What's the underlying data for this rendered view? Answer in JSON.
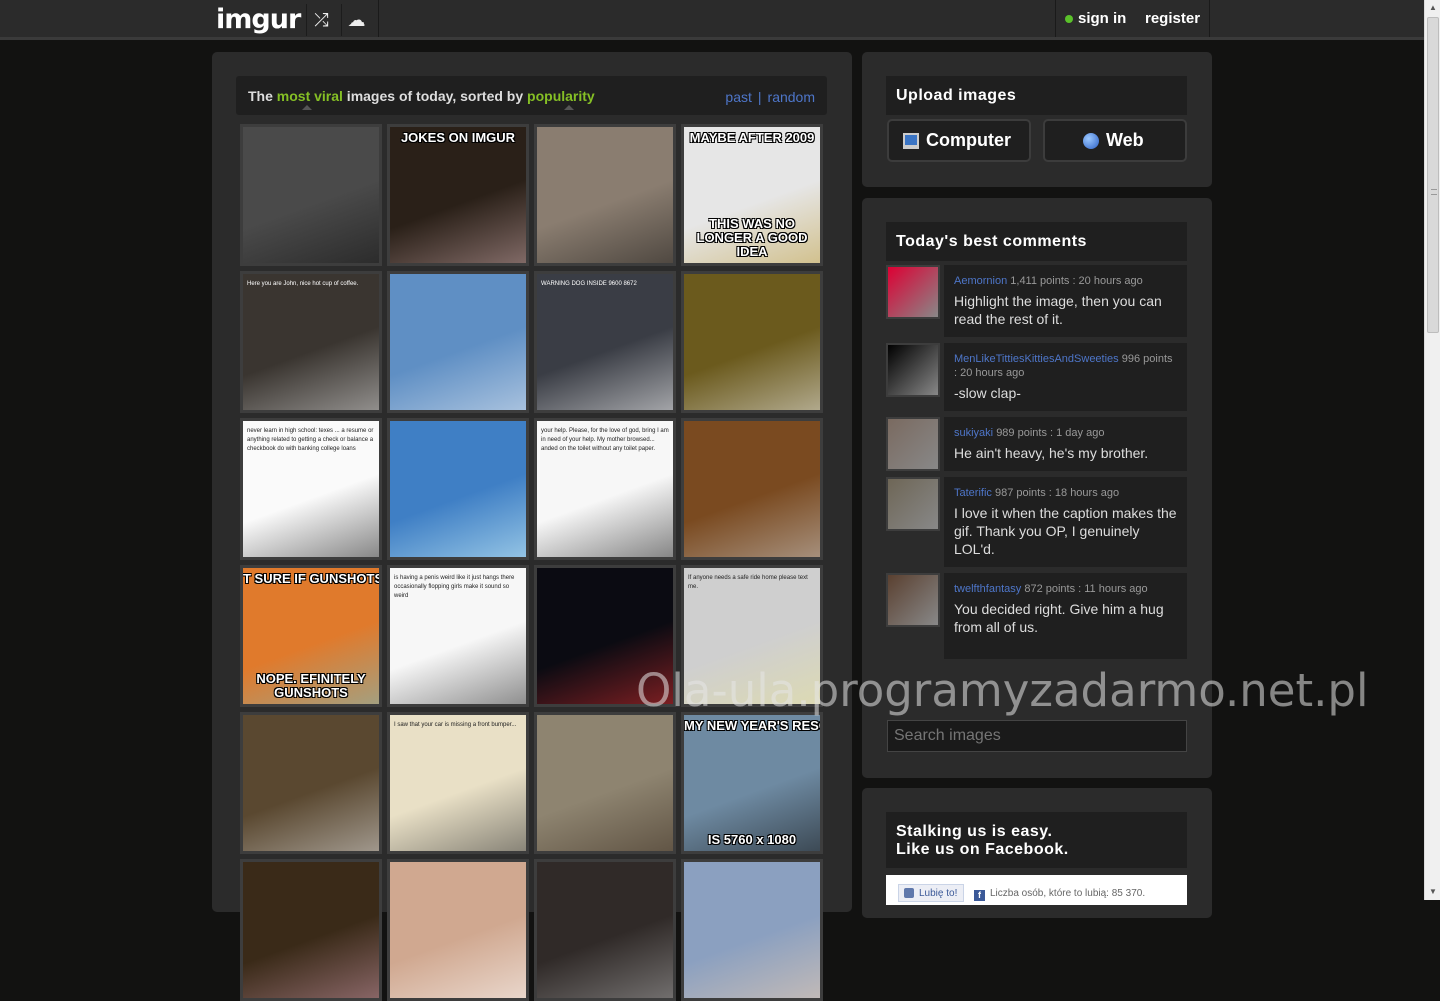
{
  "topbar": {
    "logo": "imgur",
    "random_icon": "⤮",
    "upload_icon": "☁",
    "signin": "sign in",
    "register": "register"
  },
  "gallery": {
    "title_prefix": "The ",
    "title_hl1": "most viral",
    "title_mid": " images of today, sorted by ",
    "title_hl2": "popularity",
    "link_past": "past",
    "link_sep": "|",
    "link_random": "random",
    "thumbs": [
      {
        "name": "tuxedo-cat",
        "bg": "#4a4a4a",
        "accent": "#111"
      },
      {
        "name": "most-interesting-man",
        "bg": "#2a2018",
        "accent": "#caa",
        "caption_top": "JOKES ON IMGUR"
      },
      {
        "name": "pug-puppy",
        "bg": "#8a7d70",
        "accent": "#1c1a18"
      },
      {
        "name": "new-year-meme",
        "bg": "#e6e6e6",
        "accent": "#c0a040",
        "caption_top": "MAYBE AFTER 2009",
        "caption_bottom": "THIS WAS NO LONGER A GOOD IDEA"
      },
      {
        "name": "sherlock-tea",
        "bg": "#3a3530",
        "accent": "#ddd",
        "text": "Here you are John, nice hot cup of coffee."
      },
      {
        "name": "feet-over-clouds",
        "bg": "#5f8fc4",
        "accent": "#e8eef5"
      },
      {
        "name": "warning-dog-sign",
        "bg": "#3a3d45",
        "accent": "#fff",
        "text": "WARNING DOG INSIDE 9600 8672"
      },
      {
        "name": "panda-reading",
        "bg": "#6b5a1d",
        "accent": "#eee"
      },
      {
        "name": "high-school-text",
        "bg": "#fafafa",
        "accent": "#222",
        "text": "never learn in high school: texes ... a resume or anything related to getting a check or balance a checkbook do with banking college loans"
      },
      {
        "name": "blue-bathroom",
        "bg": "#3f7fc5",
        "accent": "#dff"
      },
      {
        "name": "toilet-text",
        "bg": "#f7f7f7",
        "accent": "#222",
        "text": "your help. Please, for the love of god, bring I am in need of your help. My mother browsed... anded on the toilet without any toilet paper."
      },
      {
        "name": "brown-bathroom",
        "bg": "#7a4a20",
        "accent": "#ccc"
      },
      {
        "name": "fry-not-sure",
        "bg": "#e07a2c",
        "accent": "#6fc1c9",
        "caption_top": "T SURE IF GUNSHOTS O",
        "caption_bottom": "NOPE. EFINITELY GUNSHOTS"
      },
      {
        "name": "tumblr-text",
        "bg": "#f7f7f7",
        "accent": "#333",
        "text": "is having a penis weird like it just hangs there occasionally flopping girls make it sound so weird"
      },
      {
        "name": "fireworks-needle",
        "bg": "#0b0b12",
        "accent": "#e03030"
      },
      {
        "name": "text-messages",
        "bg": "#cfcfcf",
        "accent": "#e8e39a",
        "text": "If anyone needs a safe ride home please text me."
      },
      {
        "name": "sleeping-man",
        "bg": "#5a4830",
        "accent": "#ddd"
      },
      {
        "name": "car-note",
        "bg": "#e9e0c6",
        "accent": "#333",
        "text": "I saw that your car is missing a front bumper..."
      },
      {
        "name": "jack-sparrow",
        "bg": "#8e8470",
        "accent": "#3a2c20"
      },
      {
        "name": "monitor-setup",
        "bg": "#6e8aa2",
        "accent": "#111",
        "caption_top": "MY NEW YEAR'S RESOLUTION",
        "caption_bottom": "IS 5760 x 1080"
      },
      {
        "name": "row6-a",
        "bg": "#3a2a18",
        "accent": "#c9a"
      },
      {
        "name": "row6-b",
        "bg": "#d0a890",
        "accent": "#fff"
      },
      {
        "name": "row6-c",
        "bg": "#302a28",
        "accent": "#aaa"
      },
      {
        "name": "row6-d",
        "bg": "#8ba0c0",
        "accent": "#f0d0b0"
      }
    ]
  },
  "upload": {
    "title": "Upload images",
    "computer": "Computer",
    "web": "Web"
  },
  "comments": {
    "title": "Today's best comments",
    "items": [
      {
        "user": "Aemornion",
        "meta": "1,411 points : 20 hours ago",
        "text": "Highlight the image, then you can read the rest of it.",
        "avatar": "#d03"
      },
      {
        "user": "MenLikeTittiesKittiesAndSweeties",
        "meta": "996 points : 20 hours ago",
        "text": "-slow clap-",
        "avatar": "#000"
      },
      {
        "user": "sukiyaki",
        "meta": "989 points : 1 day ago",
        "text": "He ain't heavy, he's my brother.",
        "avatar": "#7a6a60"
      },
      {
        "user": "Taterific",
        "meta": "987 points : 18 hours ago",
        "text": "I love it when the caption makes the gif. Thank you OP, I genuinely LOL'd.",
        "avatar": "#6e6656"
      },
      {
        "user": "twelfthfantasy",
        "meta": "872 points : 11 hours ago",
        "text": "You decided right. Give him a hug from all of us.",
        "avatar": "#5a4030"
      }
    ]
  },
  "search": {
    "placeholder": "Search images"
  },
  "facebook": {
    "title_line1": "Stalking us is easy.",
    "title_line2": "Like us on Facebook.",
    "like_button": "Lubię to!",
    "count_text": "Liczba osób, które to lubią: 85 370."
  },
  "watermark": "Ola-ula.programyzadarmo.net.pl"
}
